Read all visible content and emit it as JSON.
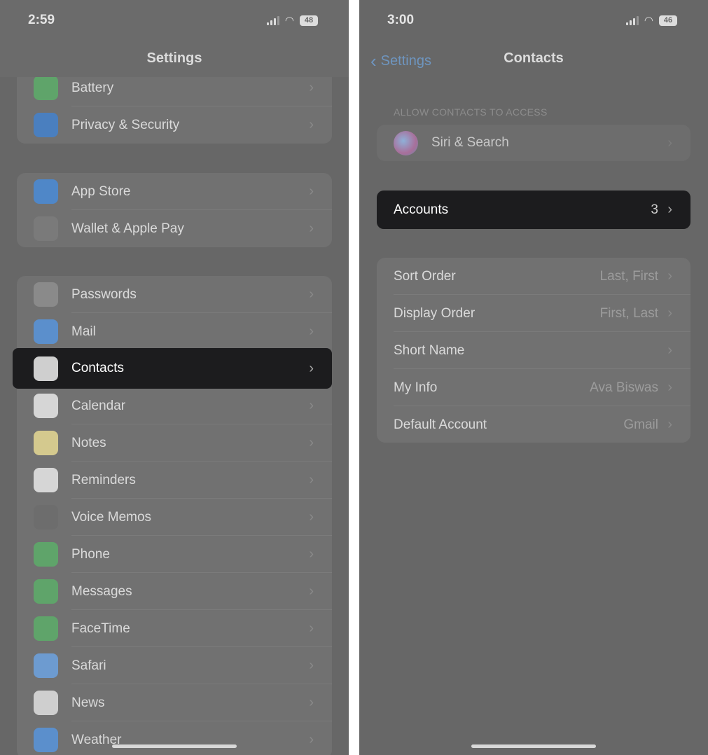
{
  "left": {
    "time": "2:59",
    "battery": "48",
    "title": "Settings",
    "groups": [
      [
        {
          "label": "Battery",
          "icon": "battery-icon",
          "color": "#5fa46a"
        },
        {
          "label": "Privacy & Security",
          "icon": "hand-icon",
          "color": "#4a7fbf"
        }
      ],
      [
        {
          "label": "App Store",
          "icon": "app-store-icon",
          "color": "#4f87c8"
        },
        {
          "label": "Wallet & Apple Pay",
          "icon": "wallet-icon",
          "color": "#7a7a7a"
        }
      ],
      [
        {
          "label": "Passwords",
          "icon": "key-icon",
          "color": "#8a8a8a"
        },
        {
          "label": "Mail",
          "icon": "mail-icon",
          "color": "#5b8fcc"
        },
        {
          "label": "Contacts",
          "icon": "contacts-icon",
          "color": "#cfcfcf",
          "highlighted": true
        },
        {
          "label": "Calendar",
          "icon": "calendar-icon",
          "color": "#d6d6d6"
        },
        {
          "label": "Notes",
          "icon": "notes-icon",
          "color": "#d4c98e"
        },
        {
          "label": "Reminders",
          "icon": "reminders-icon",
          "color": "#d6d6d6"
        },
        {
          "label": "Voice Memos",
          "icon": "voice-memos-icon",
          "color": "#6d6d6d"
        },
        {
          "label": "Phone",
          "icon": "phone-icon",
          "color": "#5fa46a"
        },
        {
          "label": "Messages",
          "icon": "messages-icon",
          "color": "#5fa46a"
        },
        {
          "label": "FaceTime",
          "icon": "facetime-icon",
          "color": "#5fa46a"
        },
        {
          "label": "Safari",
          "icon": "safari-icon",
          "color": "#6d9bd0"
        },
        {
          "label": "News",
          "icon": "news-icon",
          "color": "#cfcfcf"
        },
        {
          "label": "Weather",
          "icon": "weather-icon",
          "color": "#5b8fcc"
        }
      ]
    ]
  },
  "right": {
    "time": "3:00",
    "battery": "46",
    "back_label": "Settings",
    "title": "Contacts",
    "section_header": "ALLOW CONTACTS TO ACCESS",
    "siri": {
      "label": "Siri & Search",
      "icon": "siri-icon"
    },
    "accounts": {
      "label": "Accounts",
      "value": "3"
    },
    "settings": [
      {
        "label": "Sort Order",
        "value": "Last, First"
      },
      {
        "label": "Display Order",
        "value": "First, Last"
      },
      {
        "label": "Short Name",
        "value": ""
      },
      {
        "label": "My Info",
        "value": "Ava Biswas"
      },
      {
        "label": "Default Account",
        "value": "Gmail"
      }
    ]
  }
}
